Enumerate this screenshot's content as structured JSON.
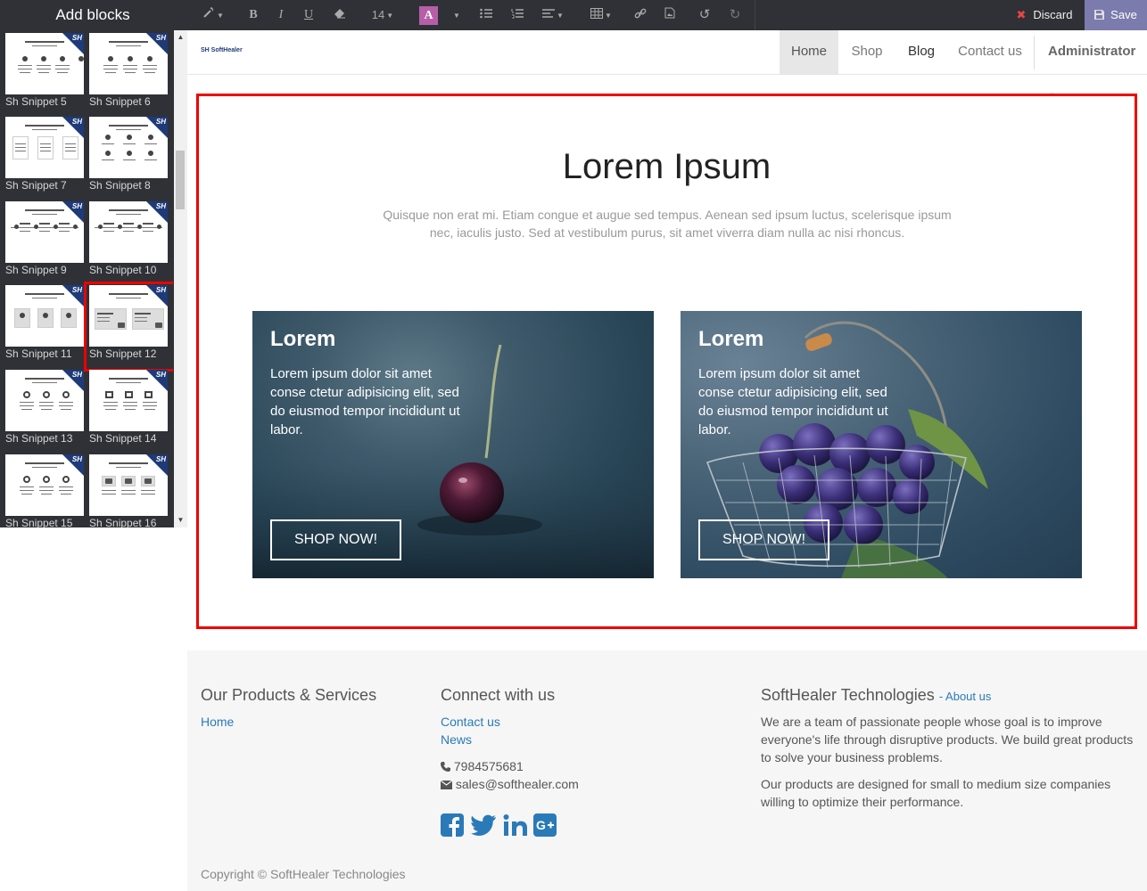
{
  "sidebar": {
    "title": "Add blocks",
    "snippets": [
      {
        "label": "Sh Snippet 5"
      },
      {
        "label": "Sh Snippet 6"
      },
      {
        "label": "Sh Snippet 7"
      },
      {
        "label": "Sh Snippet 8"
      },
      {
        "label": "Sh Snippet 9"
      },
      {
        "label": "Sh Snippet 10"
      },
      {
        "label": "Sh Snippet 11"
      },
      {
        "label": "Sh Snippet 12"
      },
      {
        "label": "Sh Snippet 13"
      },
      {
        "label": "Sh Snippet 14"
      },
      {
        "label": "Sh Snippet 15"
      },
      {
        "label": "Sh Snippet 16"
      }
    ],
    "selected_snippet": "Sh Snippet 12",
    "badge_text": "SH"
  },
  "toolbar": {
    "font_size": "14",
    "color_button": "A",
    "discard_label": "Discard",
    "save_label": "Save",
    "accent": "#7c7bad"
  },
  "navbar": {
    "logo_text": "SH SoftHealer",
    "items": [
      {
        "label": "Home"
      },
      {
        "label": "Shop"
      },
      {
        "label": "Blog"
      },
      {
        "label": "Contact us"
      }
    ],
    "user": "Administrator"
  },
  "main": {
    "title": "Lorem Ipsum",
    "description": "Quisque non erat mi. Etiam congue et augue sed tempus. Aenean sed ipsum luctus, scelerisque ipsum nec, iaculis justo. Sed at vestibulum purus, sit amet viverra diam nulla ac nisi rhoncus.",
    "cards": [
      {
        "title": "Lorem",
        "text": "Lorem ipsum dolor sit amet conse ctetur adipisicing elit, sed do eiusmod tempor incididunt ut labor.",
        "button": "SHOP NOW!"
      },
      {
        "title": "Lorem",
        "text": "Lorem ipsum dolor sit amet conse ctetur adipisicing elit, sed do eiusmod tempor incididunt ut labor.",
        "button": "SHOP NOW!"
      }
    ]
  },
  "footer": {
    "col1": {
      "heading": "Our Products & Services",
      "links": [
        "Home"
      ]
    },
    "col2": {
      "heading": "Connect with us",
      "links": [
        "Contact us",
        "News"
      ],
      "phone": "7984575681",
      "email": "sales@softhealer.com"
    },
    "col3": {
      "heading": "SoftHealer Technologies",
      "about_link": "About us",
      "p1": "We are a team of passionate people whose goal is to improve everyone's life through disruptive products. We build great products to solve your business problems.",
      "p2": "Our products are designed for small to medium size companies willing to optimize their performance."
    },
    "copyright": "Copyright © SoftHealer Technologies"
  }
}
